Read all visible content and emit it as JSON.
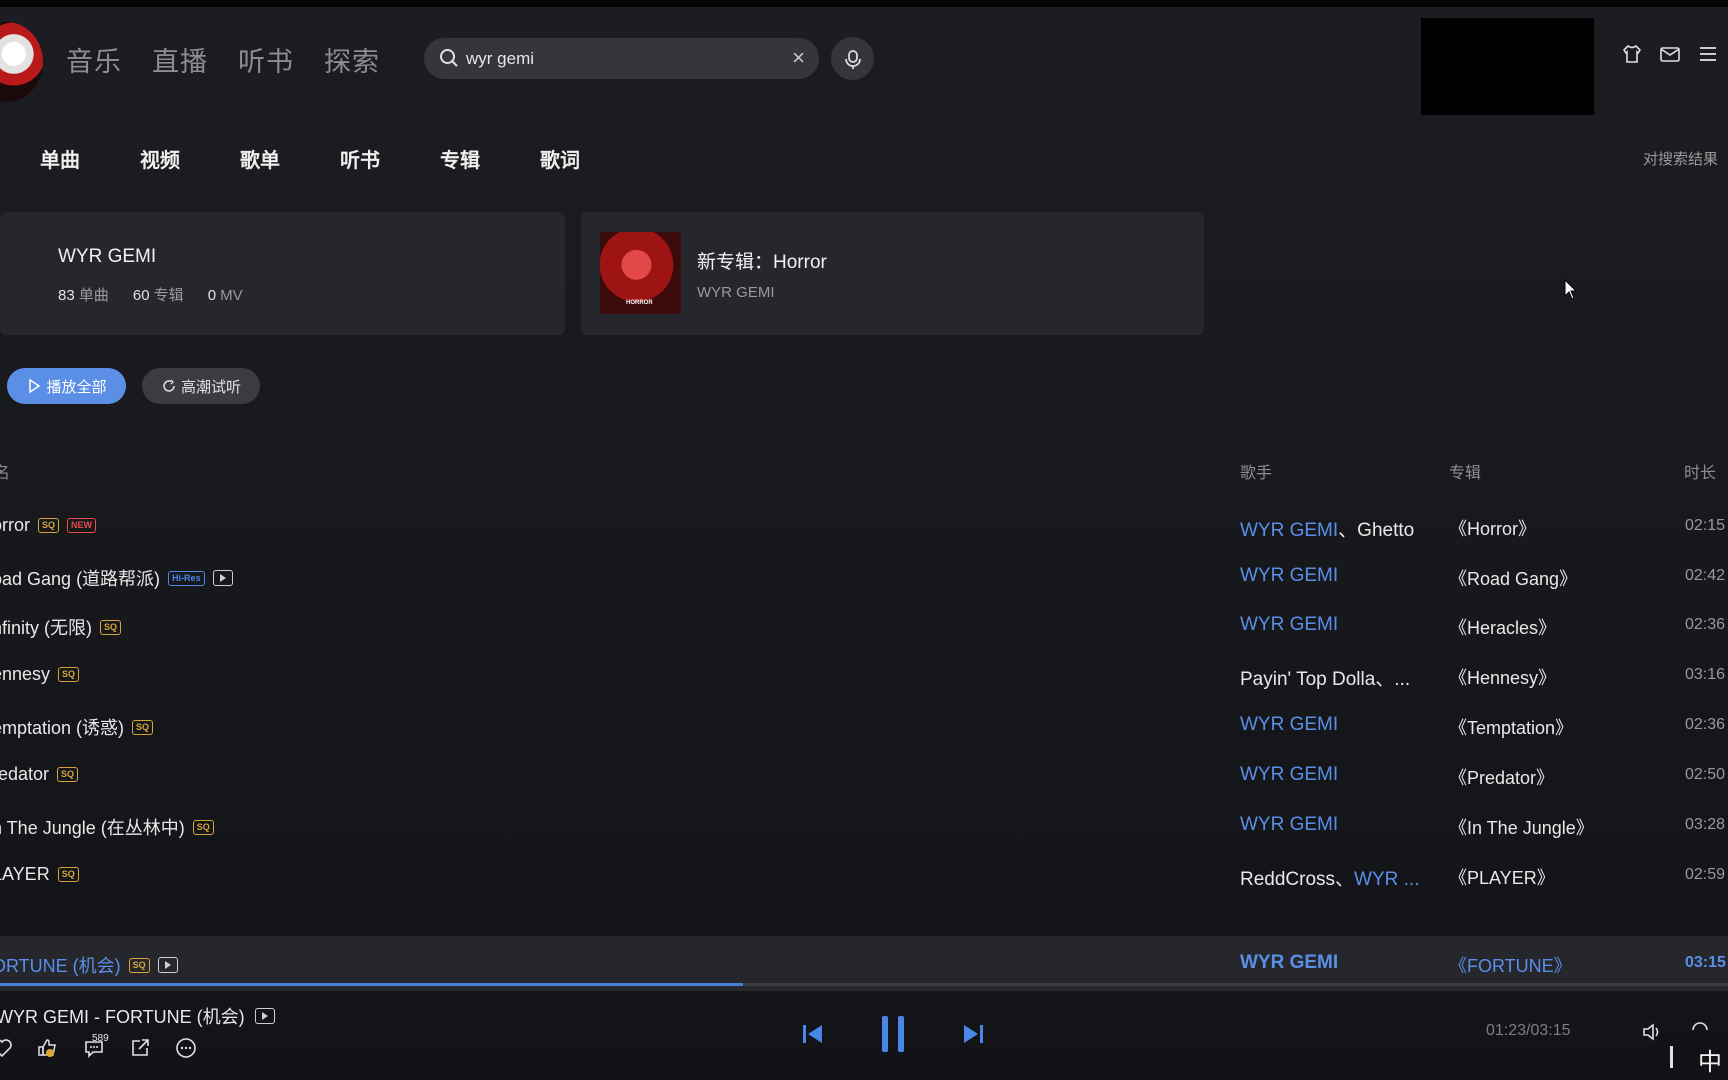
{
  "nav": [
    "音乐",
    "直播",
    "听书",
    "探索"
  ],
  "search": {
    "value": "wyr gemi",
    "clear": "×"
  },
  "tabs": [
    "单曲",
    "视频",
    "歌单",
    "听书",
    "专辑",
    "歌词"
  ],
  "search_hint": "对搜索结果",
  "artist_card": {
    "name": "WYR GEMI",
    "songs_count": "83",
    "songs_label": "单曲",
    "albums_count": "60",
    "albums_label": "专辑",
    "mv_count": "0",
    "mv_label": "MV"
  },
  "album_card": {
    "title": "新专辑：Horror",
    "artist": "WYR GEMI",
    "cover_text": "HORROR"
  },
  "buttons": {
    "play_all": "播放全部",
    "highlight": "高潮试听"
  },
  "table": {
    "headers": {
      "song": "名",
      "singer": "歌手",
      "album": "专辑",
      "duration": "时长"
    },
    "rows": [
      {
        "title": "orror",
        "badges": [
          "SQ",
          "NEW"
        ],
        "mv": false,
        "singer_link": "WYR GEMI",
        "singer_rest": "、Ghetto",
        "album": "《Horror》",
        "duration": "02:15"
      },
      {
        "title": "oad Gang (道路帮派)",
        "badges": [
          "Hi-Res"
        ],
        "mv": true,
        "singer_link": "WYR GEMI",
        "singer_rest": "",
        "album": "《Road Gang》",
        "duration": "02:42"
      },
      {
        "title": "nfinity (无限)",
        "badges": [
          "SQ"
        ],
        "mv": false,
        "singer_link": "WYR GEMI",
        "singer_rest": "",
        "album": "《Heracles》",
        "duration": "02:36"
      },
      {
        "title": "ennesy",
        "badges": [
          "SQ"
        ],
        "mv": false,
        "singer_link": "",
        "singer_rest": "Payin' Top Dolla、...",
        "album": "《Hennesy》",
        "duration": "03:16"
      },
      {
        "title": "emptation (诱惑)",
        "badges": [
          "SQ"
        ],
        "mv": false,
        "singer_link": "WYR GEMI",
        "singer_rest": "",
        "album": "《Temptation》",
        "duration": "02:36"
      },
      {
        "title": "redator",
        "badges": [
          "SQ"
        ],
        "mv": false,
        "singer_link": "WYR GEMI",
        "singer_rest": "",
        "album": "《Predator》",
        "duration": "02:50"
      },
      {
        "title": "n The Jungle (在丛林中)",
        "badges": [
          "SQ"
        ],
        "mv": false,
        "singer_link": "WYR GEMI",
        "singer_rest": "",
        "album": "《In The Jungle》",
        "duration": "03:28"
      },
      {
        "title": "LAYER",
        "badges": [
          "SQ"
        ],
        "mv": false,
        "singer_link": "",
        "singer_rest": "ReddCross、",
        "singer_link2": "WYR ...",
        "album": "《PLAYER》",
        "duration": "02:59"
      },
      {
        "title": "ORTUNE (机会)",
        "badges": [
          "SQ"
        ],
        "mv": true,
        "singer_link": "WYR GEMI",
        "singer_rest": "",
        "album": "《FORTUNE》",
        "duration": "03:15",
        "active": true
      }
    ]
  },
  "player": {
    "song": "WYR GEMI - FORTUNE (机会)",
    "comment_count": "589",
    "time": "01:23/03:15",
    "progress": 0.43
  },
  "ime": {
    "label": "中"
  },
  "colors": {
    "accent": "#5a8fe8",
    "badge_sq": "#d4a63a",
    "badge_new": "#e84b4b"
  },
  "icons": [
    "search-icon",
    "clear-icon",
    "mic-icon",
    "skin-icon",
    "mail-icon",
    "menu-icon",
    "play-icon",
    "highlight-icon",
    "mv-icon",
    "heart-icon",
    "like-icon",
    "comment-icon",
    "share-icon",
    "more-icon",
    "prev-icon",
    "pause-icon",
    "next-icon",
    "volume-icon",
    "repeat-icon"
  ]
}
